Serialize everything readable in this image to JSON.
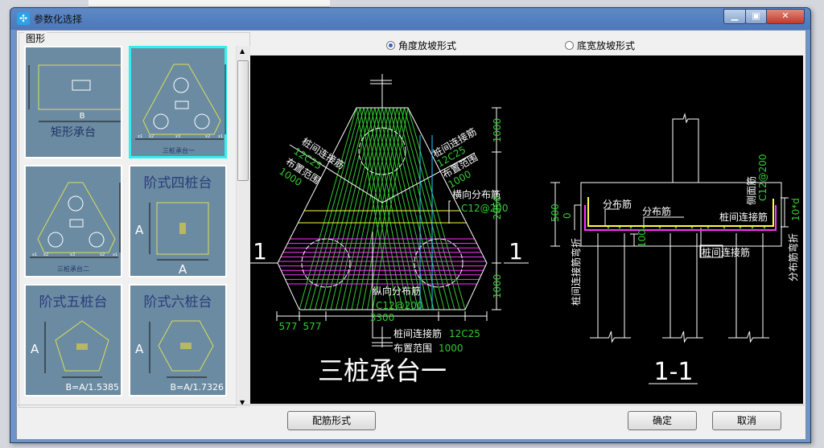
{
  "window": {
    "title": "参数化选择",
    "app_icon": "parametric-app-icon",
    "controls": [
      "minimize",
      "maximize",
      "close"
    ]
  },
  "left_panel": {
    "group_label": "图形",
    "thumbnails": [
      {
        "label": "矩形承台",
        "dim": "B",
        "selected": false
      },
      {
        "label": "三桩承台一",
        "dims": [
          "x1",
          "x2",
          "x3",
          "x2",
          "x1",
          "x4",
          "y1",
          "y2",
          "y3"
        ],
        "selected": true
      },
      {
        "label": "三桩承台二",
        "dims": [
          "x1",
          "x2",
          "x3",
          "x2",
          "x1",
          "x4",
          "y1",
          "y2",
          "y3"
        ],
        "selected": false
      },
      {
        "label": "阶式四桩台",
        "dim": "A",
        "selected": false
      },
      {
        "label": "阶式五桩台",
        "dim": "A",
        "formula": "B=A/1.5385",
        "selected": false
      },
      {
        "label": "阶式六桩台",
        "dim": "A",
        "formula": "B=A/1.7326",
        "selected": false
      }
    ]
  },
  "options": {
    "radio": [
      {
        "label": "角度放坡形式",
        "checked": true
      },
      {
        "label": "底宽放坡形式",
        "checked": false
      }
    ]
  },
  "drawing": {
    "plan": {
      "title": "三桩承台一",
      "section_mark": "1",
      "left_label": [
        "桩间连接筋",
        "12C25",
        "布置范围",
        "1000"
      ],
      "right_label": [
        "桩间连接筋",
        "12C25",
        "布置范围",
        "1000"
      ],
      "transverse": {
        "name": "横向分布筋",
        "spec": "C12@200"
      },
      "longitudinal": {
        "name": "纵向分布筋",
        "spec": "C12@200"
      },
      "bottom_label": {
        "name1": "桩间连接筋",
        "spec1": "12C25",
        "name2": "布置范围",
        "spec2": "1000"
      },
      "dims_right": [
        "1000",
        "2858",
        "1000"
      ],
      "dims_bottom": [
        "577",
        "577",
        "3300"
      ]
    },
    "section": {
      "title": "1-1",
      "dist1": "分布筋",
      "dist2": "分布筋",
      "pile_link": "桩间连接筋",
      "pile_link2": "桩间连接筋",
      "side_bar": "侧面筋",
      "side_spec": "C12@200",
      "hook": "10*d",
      "dist_bend": "分布筋弯折",
      "link_bend": "桩间连接筋弯折",
      "h": "500",
      "zero": "0",
      "cover": "100"
    },
    "colors": {
      "background": "#000000",
      "green": "#33cc33",
      "yellow": "#ffff44",
      "magenta": "#ff33ff",
      "cyan": "#33ccff",
      "white": "#ffffff"
    }
  },
  "buttons": {
    "rebar_form": "配筋形式",
    "ok": "确定",
    "cancel": "取消"
  }
}
